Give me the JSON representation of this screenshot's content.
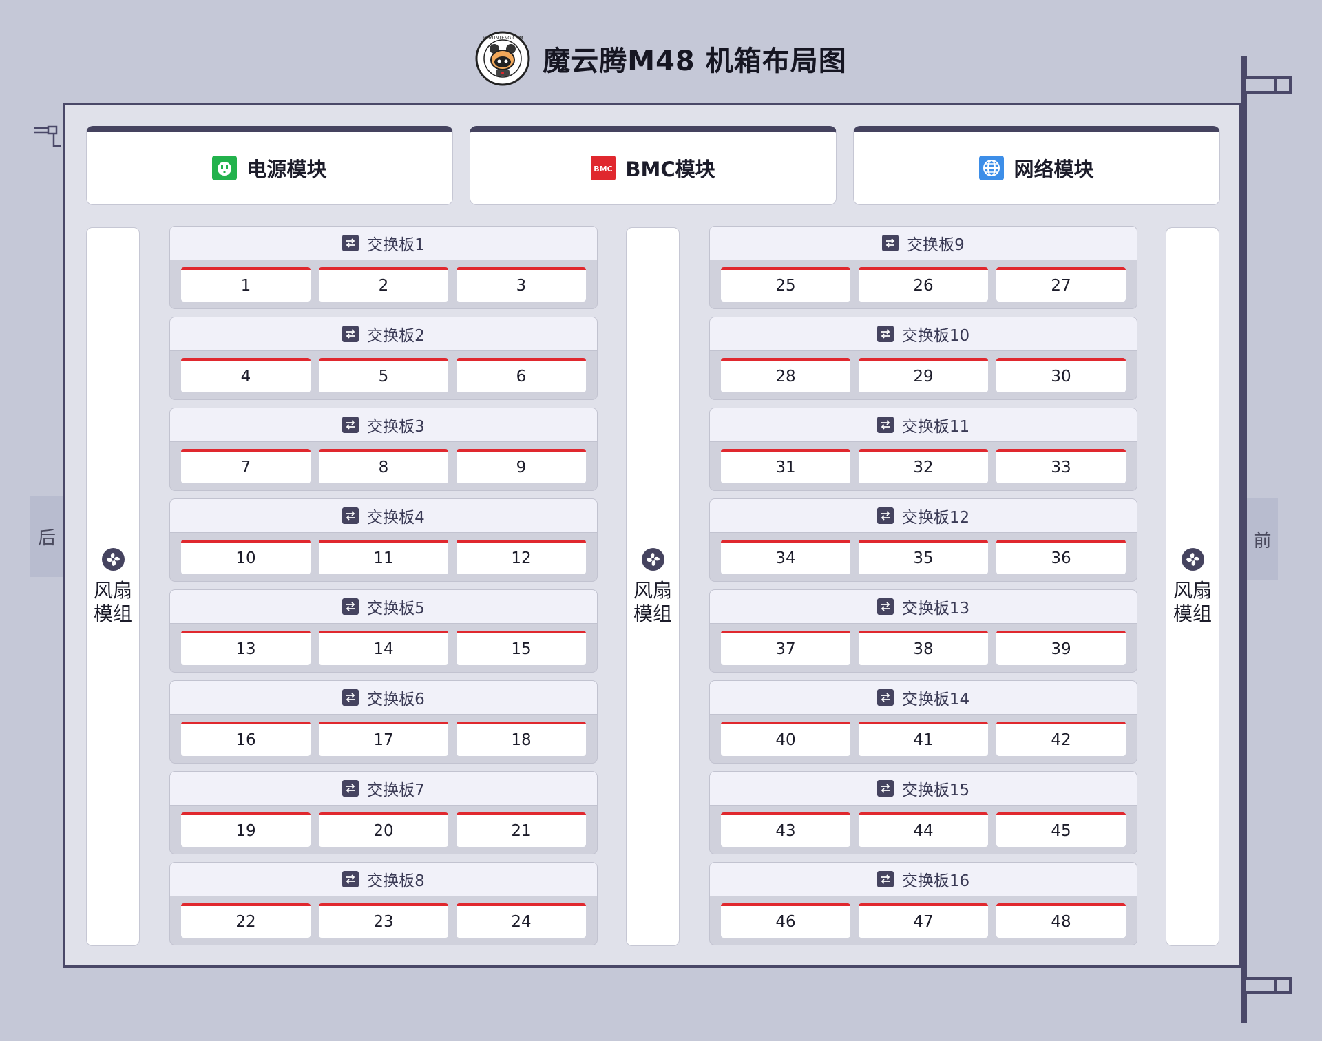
{
  "title": "魔云腾M48 机箱布局图",
  "logo": {
    "icon": "mouse-mascot-logo-icon",
    "ring_text": "MOYUNTENG.COM"
  },
  "side_labels": {
    "rear": "后",
    "front": "前"
  },
  "top_modules": [
    {
      "label": "电源模块",
      "icon": "power-socket-icon",
      "color": "#22b24c"
    },
    {
      "label": "BMC模块",
      "icon": "bmc-icon",
      "icon_text": "BMC",
      "color": "#e0282e"
    },
    {
      "label": "网络模块",
      "icon": "globe-icon",
      "color": "#3d8ee8"
    }
  ],
  "fan_modules": [
    {
      "label": "风扇模组",
      "icon": "fan-icon"
    },
    {
      "label": "风扇模组",
      "icon": "fan-icon"
    },
    {
      "label": "风扇模组",
      "icon": "fan-icon"
    }
  ],
  "boards": [
    {
      "label": "交换板1",
      "ports": [
        "1",
        "2",
        "3"
      ]
    },
    {
      "label": "交换板2",
      "ports": [
        "4",
        "5",
        "6"
      ]
    },
    {
      "label": "交换板3",
      "ports": [
        "7",
        "8",
        "9"
      ]
    },
    {
      "label": "交换板4",
      "ports": [
        "10",
        "11",
        "12"
      ]
    },
    {
      "label": "交换板5",
      "ports": [
        "13",
        "14",
        "15"
      ]
    },
    {
      "label": "交换板6",
      "ports": [
        "16",
        "17",
        "18"
      ]
    },
    {
      "label": "交换板7",
      "ports": [
        "19",
        "20",
        "21"
      ]
    },
    {
      "label": "交换板8",
      "ports": [
        "22",
        "23",
        "24"
      ]
    },
    {
      "label": "交换板9",
      "ports": [
        "25",
        "26",
        "27"
      ]
    },
    {
      "label": "交换板10",
      "ports": [
        "28",
        "29",
        "30"
      ]
    },
    {
      "label": "交换板11",
      "ports": [
        "31",
        "32",
        "33"
      ]
    },
    {
      "label": "交换板12",
      "ports": [
        "34",
        "35",
        "36"
      ]
    },
    {
      "label": "交换板13",
      "ports": [
        "37",
        "38",
        "39"
      ]
    },
    {
      "label": "交换板14",
      "ports": [
        "40",
        "41",
        "42"
      ]
    },
    {
      "label": "交换板15",
      "ports": [
        "43",
        "44",
        "45"
      ]
    },
    {
      "label": "交换板16",
      "ports": [
        "46",
        "47",
        "48"
      ]
    }
  ],
  "board_icon": "swap-arrows-icon",
  "colors": {
    "frame": "#4a4868",
    "port_accent": "#e0282e",
    "background": "#c5c8d7"
  }
}
